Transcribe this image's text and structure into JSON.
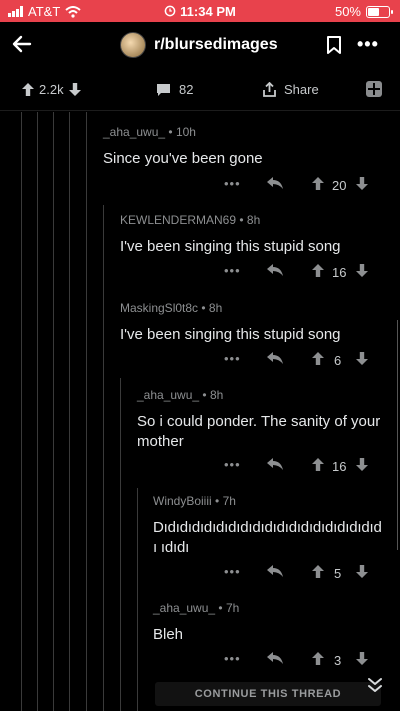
{
  "status_bar": {
    "carrier": "AT&T",
    "time": "11:34 PM",
    "battery": "50%"
  },
  "header": {
    "subreddit": "r/blursedimages"
  },
  "post_actions": {
    "votes": "2.2k",
    "comments": "82",
    "share_label": "Share"
  },
  "comments": [
    {
      "author": "_aha_uwu_",
      "age": "10h",
      "body": "Since you've been gone",
      "score": "20"
    },
    {
      "author": "KEWLENDERMAN69",
      "age": "8h",
      "body": "I've been singing this stupid song",
      "score": "16"
    },
    {
      "author": "MaskingSl0t8c",
      "age": "8h",
      "body": "I've been singing this stupid song",
      "score": "6"
    },
    {
      "author": "_aha_uwu_",
      "age": "8h",
      "body": "So i could ponder. The sanity of your mother",
      "score": "16"
    },
    {
      "author": "WindyBoiiii",
      "age": "7h",
      "body": "Dıdıdıdıdıdıdıdıdıdıdıdıdıdıdıdıdıdıdı ıdıdı",
      "score": "5"
    },
    {
      "author": "_aha_uwu_",
      "age": "7h",
      "body": "Bleh",
      "score": "3"
    }
  ],
  "continue_label": "CONTINUE THIS THREAD",
  "colors": {
    "status_bar_bg": "#e8424c",
    "background": "#000000",
    "thread_line": "#3a3a3a"
  }
}
